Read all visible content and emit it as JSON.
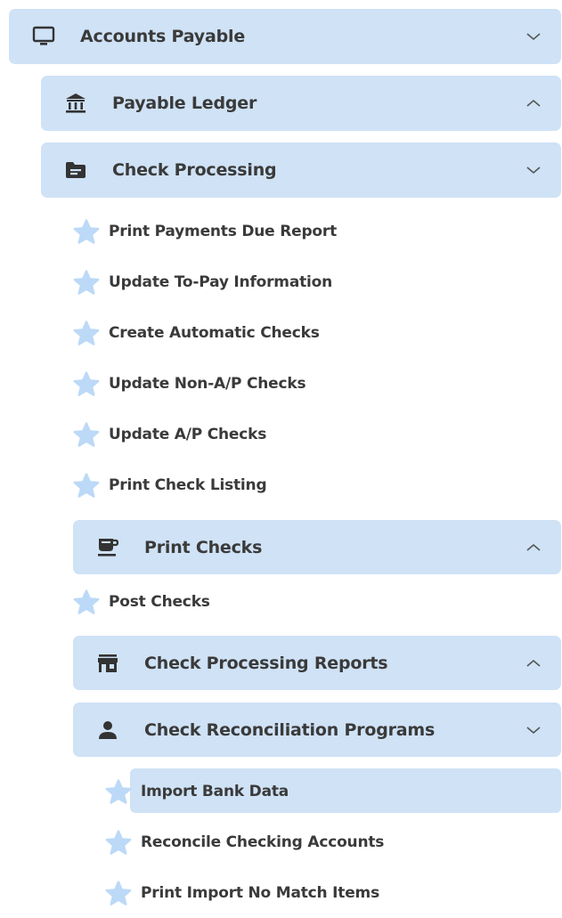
{
  "menu": {
    "accounts_payable": "Accounts Payable",
    "payable_ledger": "Payable Ledger",
    "check_processing": "Check Processing",
    "items": [
      "Print Payments Due Report",
      "Update To-Pay Information",
      "Create Automatic Checks",
      "Update Non-A/P Checks",
      "Update A/P Checks",
      "Print Check Listing"
    ],
    "print_checks": "Print Checks",
    "post_checks": "Post Checks",
    "check_processing_reports": "Check Processing Reports",
    "check_reconciliation_programs": "Check Reconciliation Programs",
    "reconciliation_items": [
      "Import Bank Data",
      "Reconcile Checking Accounts",
      "Print Import No Match Items"
    ]
  },
  "colors": {
    "group_bg": "#cfe2f6",
    "star": "#bcd9f7",
    "text": "#3a3a3a",
    "icon": "#333333"
  },
  "icons": {
    "accounts_payable": "monitor-icon",
    "payable_ledger": "bank-icon",
    "check_processing": "folder-icon",
    "print_checks": "coffee-cup-icon",
    "check_processing_reports": "store-icon",
    "check_reconciliation_programs": "person-icon",
    "leaf": "star-icon"
  }
}
